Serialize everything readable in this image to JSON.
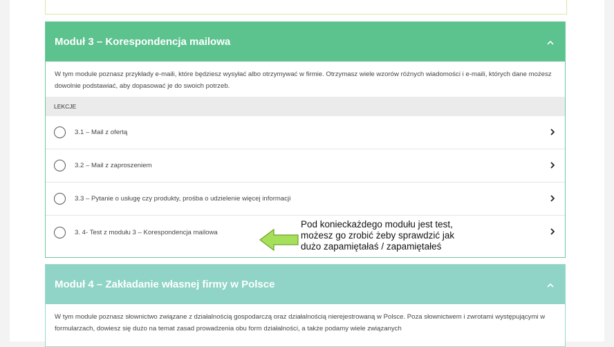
{
  "module3": {
    "title": "Moduł 3 – Korespondencja mailowa",
    "description": "W tym module poznasz przykłady e-maili, które będziesz wysyłać albo otrzymywać w firmie. Otrzymasz wiele wzorów różnych wiadomości i e-maili, których dane możesz dowolnie podstawiać, aby dopasować je do swoich potrzeb.",
    "lessons_header": "LEKCJE",
    "lessons": [
      {
        "label": "3.1 – Mail z ofertą"
      },
      {
        "label": "3.2 – Mail z zaproszeniem"
      },
      {
        "label": "3.3 – Pytanie o usługę czy produkty, prośba o udzielenie więcej informacji"
      },
      {
        "label": "3. 4- Test z modułu 3 – Korespondencja mailowa"
      }
    ],
    "accent_color": "#5cc28e"
  },
  "module4": {
    "title": "Moduł 4 – Zakładanie własnej firmy w Polsce",
    "description": "W tym module poznasz słownictwo związane z działalnością gospodarczą oraz działalnością nierejestrowaną w Polsce. Poza słownictwem i zwrotami występującymi w formularzach, dowiesz się dużo na temat zasad prowadzenia obu form działalności, a także podamy wiele związanych",
    "accent_color": "#8fd4c6"
  },
  "annotation": {
    "lines": [
      "Pod konieckażdego modułu jest test,",
      "możesz go zrobić żeby sprawdzić jak",
      "dużo zapamiętałaś / zapamiętałeś"
    ],
    "arrow_color": "#a6e05a"
  },
  "icons": {
    "collapse": "chevron-up-icon",
    "lesson_status": "circle-icon",
    "lesson_open": "chevron-right-icon"
  }
}
